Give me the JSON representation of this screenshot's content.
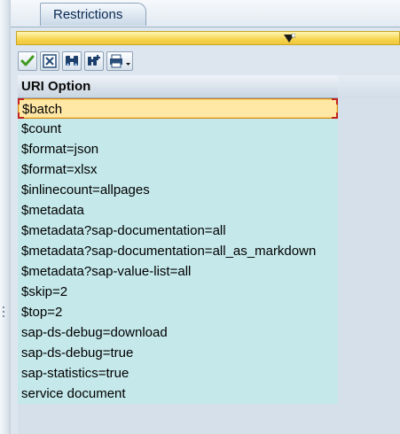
{
  "tabs": [
    {
      "label": "Restrictions"
    }
  ],
  "toolbar": {
    "buttons": [
      {
        "icon": "check-icon"
      },
      {
        "icon": "close-icon"
      },
      {
        "icon": "binoculars-icon"
      },
      {
        "icon": "find-next-icon"
      },
      {
        "icon": "print-icon"
      }
    ]
  },
  "table": {
    "column_header": "URI Option",
    "rows": [
      "$batch",
      "$count",
      "$format=json",
      "$format=xlsx",
      "$inlinecount=allpages",
      "$metadata",
      "$metadata?sap-documentation=all",
      "$metadata?sap-documentation=all_as_markdown",
      "$metadata?sap-value-list=all",
      "$skip=2",
      "$top=2",
      "sap-ds-debug=download",
      "sap-ds-debug=true",
      "sap-statistics=true",
      "service document"
    ],
    "selected_index": 0
  },
  "colors": {
    "row_bg": "#c5e8ea",
    "selected_bg": "#ffe8a6",
    "status_bar": "#f6d54e"
  }
}
